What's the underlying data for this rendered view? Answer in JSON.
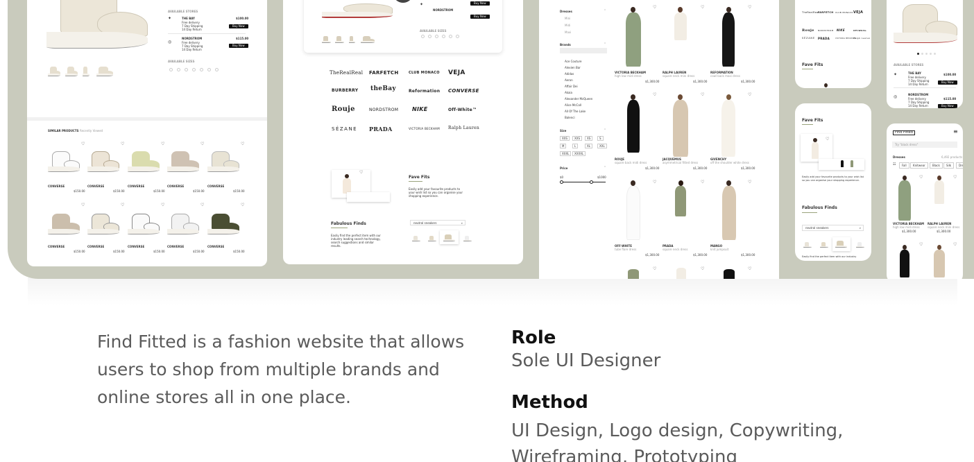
{
  "colors": {
    "frame": "#c9cbbd",
    "accent_green": "#9aa37c",
    "dark": "#111111",
    "text_grey": "#5b5b5b"
  },
  "panel1": {
    "available_stores": "AVAILABLE STORES",
    "stores": [
      {
        "name": "THE BAY",
        "price": "$100.00",
        "details": [
          "Free delivery",
          "7 Day Shipping",
          "14 Day Return"
        ],
        "cta": "Buy Now"
      },
      {
        "name": "NORDSTROM",
        "price": "$115.00",
        "details": [
          "Free delivery",
          "7 Day Shipping",
          "14 Day Return"
        ],
        "cta": "Buy Now"
      }
    ],
    "available_sizes": "AVAILABLE SIZES",
    "sizes": [
      "6",
      "6.5",
      "7",
      "7.5",
      "8",
      "8.5",
      "9"
    ],
    "similar_products": "SIMILAR PRODUCTS",
    "recently_viewed": "Recently Viewed",
    "products_row1": [
      {
        "brand": "CONVERSE",
        "price": "$150.00"
      },
      {
        "brand": "CONVERSE",
        "price": "$150.00"
      },
      {
        "brand": "CONVERSE",
        "price": "$150.00"
      },
      {
        "brand": "CONVERSE",
        "price": "$150.00"
      },
      {
        "brand": "CONVERSE",
        "price": "$150.00"
      }
    ],
    "products_row2": [
      {
        "brand": "CONVERSE",
        "price": "$150.00"
      },
      {
        "brand": "CONVERSE",
        "price": "$150.00"
      },
      {
        "brand": "CONVERSE",
        "price": "$150.00"
      },
      {
        "brand": "CONVERSE",
        "price": "$150.00"
      },
      {
        "brand": "CONVERSE",
        "price": "$150.00"
      }
    ]
  },
  "panel2": {
    "stores": [
      "NORDSTROM"
    ],
    "buy_now": "Buy Now",
    "available_sizes": "AVAILABLE SIZES",
    "brands": [
      "TheRealReal",
      "FARFETCH",
      "CLUB MONACO",
      "VEJA",
      "BURBERRY",
      "theBay",
      "Reformation",
      "CONVERSE",
      "Rouje",
      "NORDSTROM",
      "NIKE",
      "Off-White™",
      "SÉZANE",
      "PRADA",
      "VICTORIA BECKHAM",
      "Ralph Lauren"
    ],
    "fave_fits_title": "Fave Fits",
    "fave_fits_text": "Easily add your favourite products to your wish list so you can organise your shopping experience.",
    "fabulous_finds_title": "Fabulous Finds",
    "fabulous_finds_text": "Easily find the perfect item with our industry leading search technology, search suggestions and similar results.",
    "search_value": "neutral sneakers"
  },
  "panel3": {
    "filter_dresses": "Dresses",
    "dresses_options": [
      "Mini",
      "Midi",
      "Maxi"
    ],
    "filter_brands": "Brands",
    "brand_options": [
      "Ace Couture",
      "Alexien Bar",
      "Adidas",
      "Aeron",
      "Affair Dei",
      "Akaia",
      "Alexander McQueen",
      "Alice McCall",
      "All Of The Lake",
      "Balenci"
    ],
    "filter_size": "Size",
    "sizes": [
      "XXS",
      "XXS",
      "XS",
      "S",
      "M",
      "L",
      "XL",
      "XXL",
      "XXXL",
      "XXXXL"
    ],
    "filter_price": "Price",
    "price_min": "$0",
    "price_max": "$1000",
    "products": [
      {
        "brand": "VICTORIA BECKHAM",
        "desc": "high low midi dress",
        "price": "$1,300.00"
      },
      {
        "brand": "RALPH LAUREN",
        "desc": "square neck mini dress",
        "price": "$1,300.00"
      },
      {
        "brand": "REFORMATION",
        "desc": "cowl back maxi dress",
        "price": "$1,300.00"
      },
      {
        "brand": "ROUJE",
        "desc": "square back midi dress",
        "price": "$1,300.00"
      },
      {
        "brand": "JACQUEMUS",
        "desc": "asymmetrical fitted dress",
        "price": "$1,300.00"
      },
      {
        "brand": "GIVENCHY",
        "desc": "off the shoulder white dress",
        "price": "$1,300.00"
      },
      {
        "brand": "OFF-WHITE",
        "desc": "tube flare dress",
        "price": "$1,300.00"
      },
      {
        "brand": "PRADA",
        "desc": "square neck dress",
        "price": "$1,300.00"
      },
      {
        "brand": "MANGO",
        "desc": "knit jumpsuit",
        "price": "$1,300.00"
      }
    ]
  },
  "panel4": {
    "brands": [
      "TheRealReal",
      "FARFETCH",
      "CLUB MONACO",
      "VEJA",
      "Rouje",
      "NORDSTROM",
      "NIKE",
      "Off-White",
      "SÉZANE",
      "PRADA",
      "VICTORIA BECKHAM",
      "Ralph Lauren"
    ],
    "fave_fits_title": "Fave Fits"
  },
  "panel5": {
    "fave_fits_title": "Fave Fits",
    "fave_fits_text": "Easily add your favourite products to your wish list so you can organise your shopping experience.",
    "fabulous_finds_title": "Fabulous Finds",
    "search_value": "neutral sneakers",
    "fabulous_finds_text": "Easily find the perfect item with our industry"
  },
  "panel6": {
    "available_stores": "AVAILABLE STORES",
    "stores": [
      {
        "name": "THE BAY",
        "price": "$100.00",
        "details": [
          "Free delivery",
          "7 Day Shipping",
          "14 Day Return"
        ],
        "cta": "Buy Now"
      },
      {
        "name": "NORDSTROM",
        "price": "$115.00",
        "details": [
          "Free delivery",
          "7 Day Shipping",
          "14 Day Return"
        ],
        "cta": "Buy Now"
      }
    ]
  },
  "panel7": {
    "logo": "Find Fitted",
    "search_placeholder": "Try \"black dress\"",
    "category": "Dresses",
    "product_count": "6,492 products",
    "chips": [
      "Fall",
      "Knitwear",
      "Black",
      "Silk",
      "Dresses"
    ],
    "products": [
      {
        "brand": "VICTORIA BECKHAM",
        "desc": "high low midi dress",
        "price": "$1,300.00"
      },
      {
        "brand": "RALPH LAUREN",
        "desc": "square neck mini dress",
        "price": "$1,300.00"
      }
    ]
  },
  "description": "Find Fitted is a fashion website that allows users to shop from multiple brands and online stores all in one place.",
  "role": {
    "heading": "Role",
    "value": "Sole UI Designer"
  },
  "method": {
    "heading": "Method",
    "value": "UI Design, Logo design, Copywriting, Wireframing, Prototyping"
  }
}
